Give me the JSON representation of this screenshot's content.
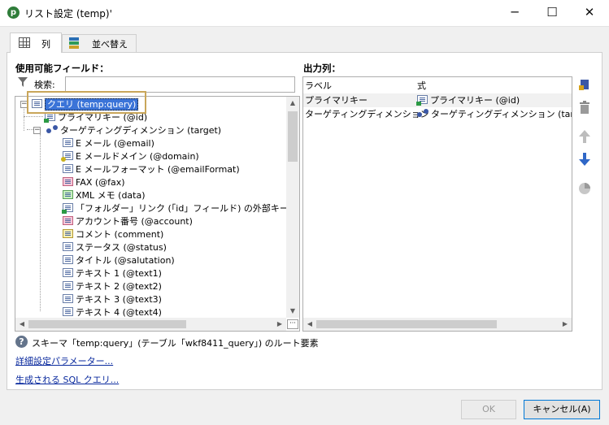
{
  "window": {
    "title": "リスト設定 (temp)'",
    "app_icon_glyph": "p",
    "controls": {
      "minimize": "─",
      "maximize": "☐",
      "close": "✕"
    }
  },
  "tabs": [
    {
      "label": "列",
      "icon": "grid-icon",
      "active": true
    },
    {
      "label": "並べ替え",
      "icon": "stack-sort-icon",
      "active": false
    }
  ],
  "available_fields": {
    "title": "使用可能フィールド：",
    "search_label": "検索:",
    "search_value": "",
    "tree": [
      {
        "label": "クエリ (temp:query)",
        "icon": "folder-list-icon",
        "selected": true,
        "expander": "⊟"
      },
      {
        "label": "プライマリキー (@id)",
        "icon": "primary-key-icon"
      },
      {
        "label": "ターゲティングディメンション (target)",
        "icon": "link-icon",
        "expander": "⊟"
      },
      {
        "label": "E メール (@email)",
        "icon": "field-icon"
      },
      {
        "label": "E メールドメイン (@domain)",
        "icon": "computed-field-icon"
      },
      {
        "label": "E メールフォーマット (@emailFormat)",
        "icon": "field-icon"
      },
      {
        "label": "FAX (@fax)",
        "icon": "pink-field-icon"
      },
      {
        "label": "XML メモ (data)",
        "icon": "green-field-icon"
      },
      {
        "label": "「フォルダー」リンク (「id」フィールド) の外部キー (@folde",
        "icon": "foreign-key-icon"
      },
      {
        "label": "アカウント番号 (@account)",
        "icon": "pink-field-icon"
      },
      {
        "label": "コメント (comment)",
        "icon": "yellow-field-icon"
      },
      {
        "label": "ステータス (@status)",
        "icon": "field-icon"
      },
      {
        "label": "タイトル (@salutation)",
        "icon": "field-icon"
      },
      {
        "label": "テキスト 1 (@text1)",
        "icon": "field-icon"
      },
      {
        "label": "テキスト 2 (@text2)",
        "icon": "field-icon"
      },
      {
        "label": "テキスト 3 (@text3)",
        "icon": "field-icon"
      },
      {
        "label": "テキスト 4 (@text4)",
        "icon": "field-icon"
      }
    ]
  },
  "output_columns": {
    "title": "出力列：",
    "headers": {
      "label": "ラベル",
      "expression": "式"
    },
    "rows": [
      {
        "label": "プライマリキー",
        "expression": "プライマリキー (@id)",
        "icon": "primary-key-icon"
      },
      {
        "label": "ターゲティングディメンション",
        "expression": "ターゲティングディメンション (target)",
        "icon": "link-icon"
      }
    ]
  },
  "side_toolbar": [
    "add-column-icon",
    "trash-icon",
    "move-up-icon",
    "move-down-icon",
    "distribution-icon"
  ],
  "footer": {
    "info": "スキーマ「temp:query」(テーブル「wkf8411_query」) のルート要素",
    "advanced_params_link": "詳細設定パラメーター...",
    "sql_link": "生成される SQL クエリ...",
    "ok_label": "OK",
    "cancel_label": "キャンセル(A)"
  },
  "colors": {
    "selection": "#3b74d8",
    "highlight_box": "#c9a65a",
    "link": "#0a2a9e",
    "accent_border": "#0078d7"
  }
}
